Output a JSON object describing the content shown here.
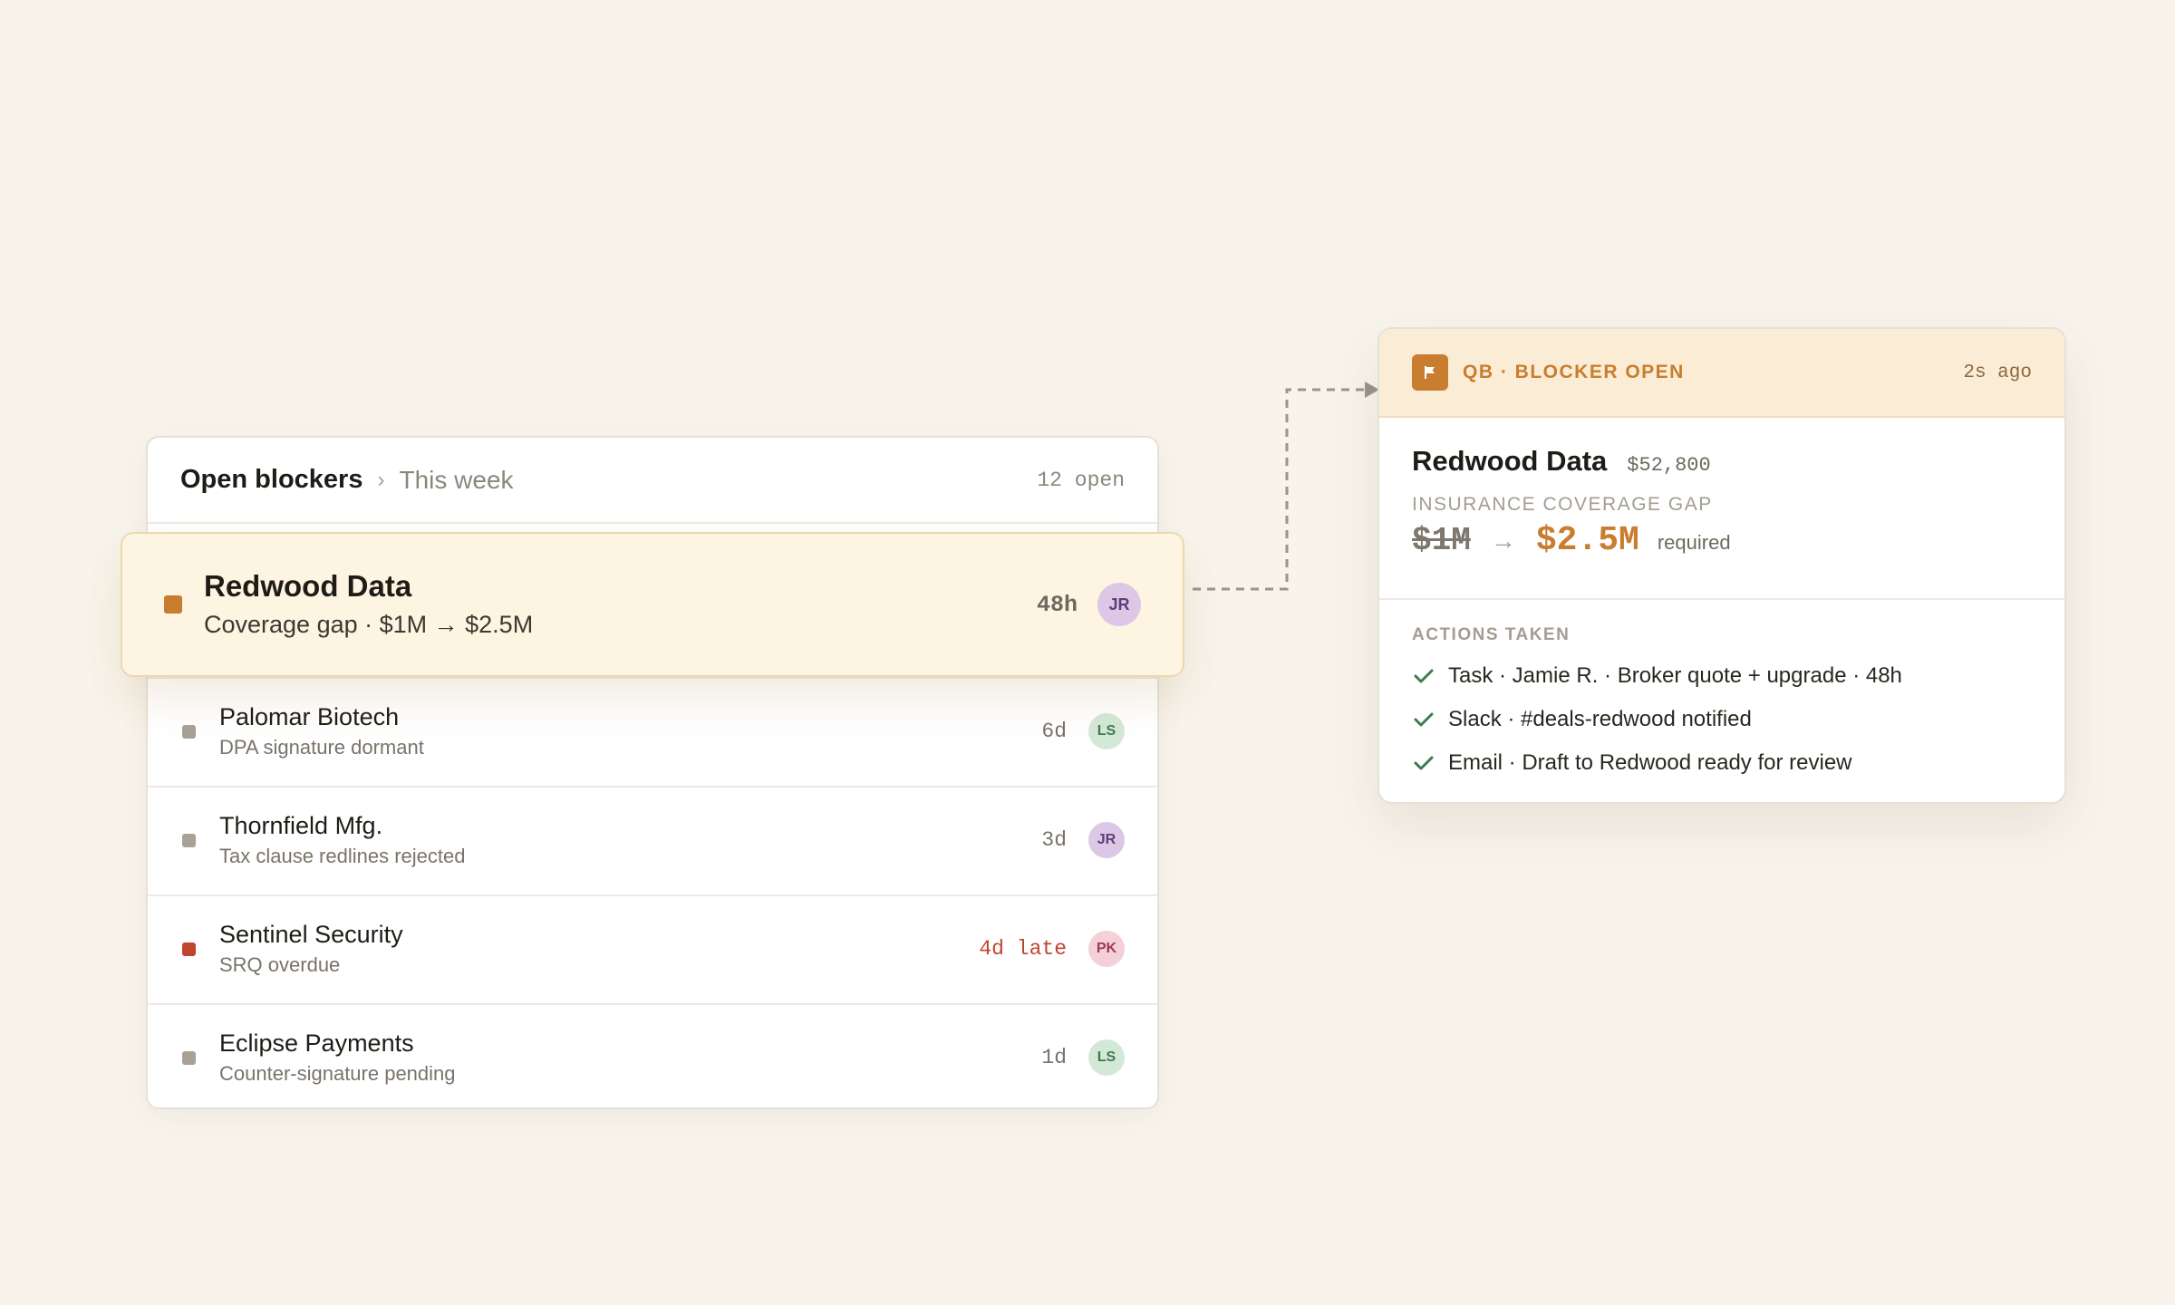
{
  "list": {
    "title": "Open blockers",
    "separator": "›",
    "subtitle": "This week",
    "count": "12 open"
  },
  "highlight": {
    "name": "Redwood Data",
    "desc": "Coverage gap · $1M → $2.5M",
    "age": "48h",
    "avatar": "JR"
  },
  "rows": [
    {
      "name": "Palomar Biotech",
      "desc": "DPA signature dormant",
      "age": "6d",
      "avatar": "LS",
      "status": "neutral"
    },
    {
      "name": "Thornfield Mfg.",
      "desc": "Tax clause redlines rejected",
      "age": "3d",
      "avatar": "JR",
      "status": "neutral"
    },
    {
      "name": "Sentinel Security",
      "desc": "SRQ overdue",
      "age": "4d late",
      "avatar": "PK",
      "status": "late"
    },
    {
      "name": "Eclipse Payments",
      "desc": "Counter-signature pending",
      "age": "1d",
      "avatar": "LS",
      "status": "neutral"
    }
  ],
  "card": {
    "header_label": "QB · BLOCKER OPEN",
    "time": "2s ago",
    "flag_icon": "flag-icon",
    "title": "Redwood Data",
    "amount": "$52,800",
    "gap_label": "INSURANCE COVERAGE GAP",
    "gap_old": "$1M",
    "gap_arrow": "→",
    "gap_new": "$2.5M",
    "gap_req": "required",
    "actions_label": "ACTIONS TAKEN",
    "actions": [
      "Task · Jamie R. · Broker quote + upgrade · 48h",
      "Slack · #deals-redwood notified",
      "Email · Draft to Redwood ready for review"
    ]
  },
  "colors": {
    "accent": "#c97d2e",
    "late": "#c0452f",
    "background": "#f8f4ec"
  }
}
